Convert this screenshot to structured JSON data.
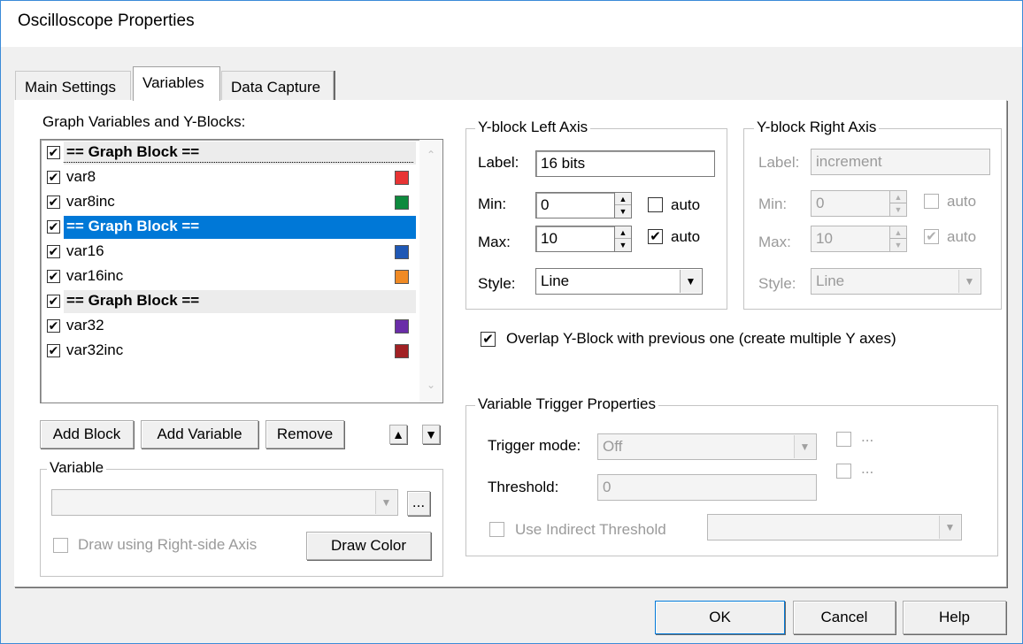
{
  "window": {
    "title": "Oscilloscope Properties"
  },
  "tabs": [
    {
      "label": "Main Settings",
      "active": false
    },
    {
      "label": "Variables",
      "active": true
    },
    {
      "label": "Data Capture",
      "active": false
    }
  ],
  "variables_list": {
    "label": "Graph Variables and Y-Blocks:",
    "rows": [
      {
        "type": "block",
        "text": "== Graph Block ==",
        "checked": true,
        "selected": false
      },
      {
        "type": "var",
        "text": "var8",
        "checked": true,
        "color": "#e83434"
      },
      {
        "type": "var",
        "text": "var8inc",
        "checked": true,
        "color": "#0e8a3e"
      },
      {
        "type": "block",
        "text": "== Graph Block ==",
        "checked": true,
        "selected": true
      },
      {
        "type": "var",
        "text": "var16",
        "checked": true,
        "color": "#1f58b5"
      },
      {
        "type": "var",
        "text": "var16inc",
        "checked": true,
        "color": "#f08a24"
      },
      {
        "type": "block",
        "text": "== Graph Block ==",
        "checked": true,
        "selected": false
      },
      {
        "type": "var",
        "text": "var32",
        "checked": true,
        "color": "#6a2da8"
      },
      {
        "type": "var",
        "text": "var32inc",
        "checked": true,
        "color": "#a12124"
      }
    ]
  },
  "list_buttons": {
    "add_block": "Add Block",
    "add_variable": "Add Variable",
    "remove": "Remove"
  },
  "variable_group": {
    "label": "Variable",
    "combo_value": "",
    "browse_label": "...",
    "right_axis_label": "Draw using Right-side Axis",
    "draw_color_label": "Draw Color"
  },
  "left_axis": {
    "title": "Y-block Left Axis",
    "label_caption": "Label:",
    "label_value": "16 bits",
    "min_caption": "Min:",
    "min_value": "0",
    "min_auto_label": "auto",
    "min_auto": false,
    "max_caption": "Max:",
    "max_value": "10",
    "max_auto_label": "auto",
    "max_auto": true,
    "style_caption": "Style:",
    "style_value": "Line"
  },
  "right_axis": {
    "title": "Y-block Right Axis",
    "label_caption": "Label:",
    "label_value": "increment",
    "min_caption": "Min:",
    "min_value": "0",
    "min_auto_label": "auto",
    "max_caption": "Max:",
    "max_value": "10",
    "max_auto_label": "auto",
    "style_caption": "Style:",
    "style_value": "Line"
  },
  "overlap": {
    "label": "Overlap Y-Block with previous one (create multiple Y axes)",
    "checked": true
  },
  "trigger": {
    "title": "Variable Trigger Properties",
    "mode_caption": "Trigger mode:",
    "mode_value": "Off",
    "check1_label": "...",
    "check2_label": "...",
    "threshold_caption": "Threshold:",
    "threshold_value": "0",
    "indirect_label": "Use Indirect Threshold",
    "indirect_value": ""
  },
  "footer": {
    "ok": "OK",
    "cancel": "Cancel",
    "help": "Help"
  },
  "glyphs": {
    "check": "✔",
    "up": "▲",
    "down": "▼",
    "combo": "▼"
  }
}
